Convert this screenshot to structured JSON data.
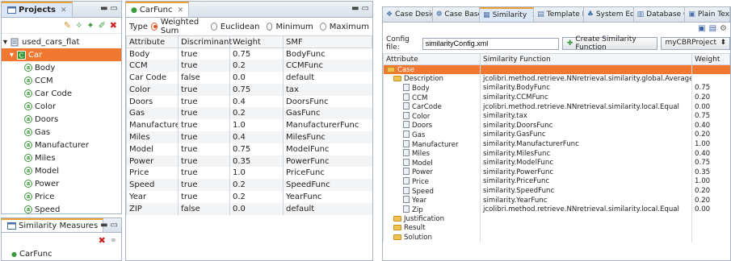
{
  "projects": {
    "title": "Projects",
    "project_name": "used_cars_flat",
    "case_name": "Car",
    "attributes": [
      "Body",
      "CCM",
      "Car Code",
      "Color",
      "Doors",
      "Gas",
      "Manufacturer",
      "Miles",
      "Model",
      "Power",
      "Price",
      "Speed",
      "Year",
      "ZIP"
    ]
  },
  "similarity_measures": {
    "title": "Similarity Measures",
    "items": [
      "CarFunc"
    ]
  },
  "carfunc": {
    "tab_title": "CarFunc",
    "type_label": "Type",
    "types": [
      {
        "label": "Weighted Sum",
        "selected": true
      },
      {
        "label": "Euclidean",
        "selected": false
      },
      {
        "label": "Minimum",
        "selected": false
      },
      {
        "label": "Maximum",
        "selected": false
      }
    ],
    "columns": [
      "Attribute",
      "Discriminant",
      "Weight",
      "SMF"
    ],
    "rows": [
      [
        "Body",
        "true",
        "0.75",
        "BodyFunc"
      ],
      [
        "CCM",
        "true",
        "0.2",
        "CCMFunc"
      ],
      [
        "Car Code",
        "false",
        "0.0",
        "default"
      ],
      [
        "Color",
        "true",
        "0.75",
        "tax"
      ],
      [
        "Doors",
        "true",
        "0.4",
        "DoorsFunc"
      ],
      [
        "Gas",
        "true",
        "0.2",
        "GasFunc"
      ],
      [
        "Manufacturer",
        "true",
        "1.0",
        "ManufacturerFunc"
      ],
      [
        "Miles",
        "true",
        "0.4",
        "MilesFunc"
      ],
      [
        "Model",
        "true",
        "0.75",
        "ModelFunc"
      ],
      [
        "Power",
        "true",
        "0.35",
        "PowerFunc"
      ],
      [
        "Price",
        "true",
        "1.0",
        "PriceFunc"
      ],
      [
        "Speed",
        "true",
        "0.2",
        "SpeedFunc"
      ],
      [
        "Year",
        "true",
        "0.2",
        "YearFunc"
      ],
      [
        "ZIP",
        "false",
        "0.0",
        "default"
      ]
    ]
  },
  "editor": {
    "tabs": [
      {
        "label": "Case Desig",
        "active": false
      },
      {
        "label": "Case Base",
        "active": false
      },
      {
        "label": "Similarity",
        "active": true
      },
      {
        "label": "Template E",
        "active": false
      },
      {
        "label": "System Edi",
        "active": false
      },
      {
        "label": "Database C",
        "active": false
      },
      {
        "label": "Plain Text",
        "active": false
      }
    ],
    "config_label": "Config file:",
    "config_value": "similarityConfig.xml",
    "create_button": "Create Similarity Function",
    "project_combo": "myCBRProject",
    "columns": [
      "Attribute",
      "Similarity Function",
      "Weight"
    ],
    "case_label": "Case",
    "description_label": "Description",
    "description_func": "jcolibri.method.retrieve.NNretrieval.similarity.global.Average",
    "rows": [
      [
        "Body",
        "similarity.BodyFunc",
        "0.75"
      ],
      [
        "CCM",
        "similarity.CCMFunc",
        "0.20"
      ],
      [
        "CarCode",
        "jcolibri.method.retrieve.NNretrieval.similarity.local.Equal",
        "0.00"
      ],
      [
        "Color",
        "similarity.tax",
        "0.75"
      ],
      [
        "Doors",
        "similarity.DoorsFunc",
        "0.40"
      ],
      [
        "Gas",
        "similarity.GasFunc",
        "0.20"
      ],
      [
        "Manufacturer",
        "similarity.ManufacturerFunc",
        "1.00"
      ],
      [
        "Miles",
        "similarity.MilesFunc",
        "0.40"
      ],
      [
        "Model",
        "similarity.ModelFunc",
        "0.75"
      ],
      [
        "Power",
        "similarity.PowerFunc",
        "0.35"
      ],
      [
        "Price",
        "similarity.PriceFunc",
        "1.00"
      ],
      [
        "Speed",
        "similarity.SpeedFunc",
        "0.20"
      ],
      [
        "Year",
        "similarity.YearFunc",
        "0.20"
      ],
      [
        "Zip",
        "jcolibri.method.retrieve.NNretrieval.similarity.local.Equal",
        "0.00"
      ]
    ],
    "other_sections": [
      "Justification",
      "Result",
      "Solution"
    ]
  }
}
